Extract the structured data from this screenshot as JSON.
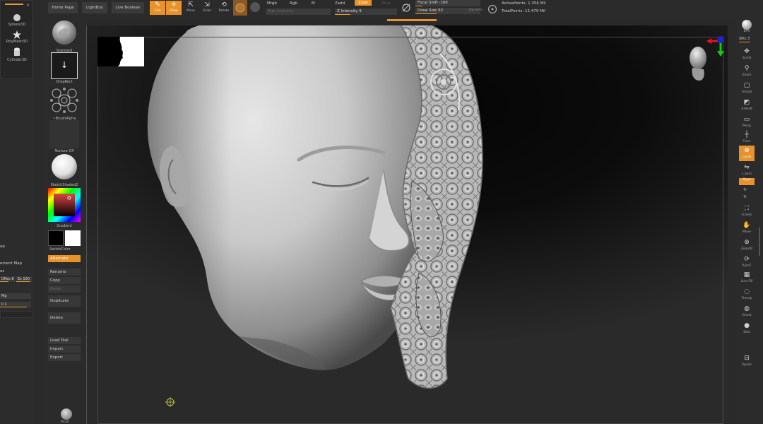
{
  "tray": {
    "primitives": [
      {
        "label": "Sphere3D",
        "icon": "sphere-icon"
      },
      {
        "label": "PolyMesh3D",
        "icon": "star-icon"
      },
      {
        "label": "Cylinder3D",
        "icon": "cylinder-icon"
      }
    ],
    "labels": {
      "map": "ap",
      "displacement_map": "ement Map",
      "res": "es"
    },
    "sliders": {
      "dres": "DRes 8",
      "es": "Es 100",
      "mp": "Mp",
      "count": "ii 1"
    }
  },
  "topbar": {
    "home_page": "Home Page",
    "lightbox": "LightBox",
    "live_boolean": "Live Boolean",
    "tools": [
      {
        "label": "Edit",
        "icon": "edit-icon",
        "active": true
      },
      {
        "label": "Draw",
        "icon": "draw-icon",
        "active": true
      },
      {
        "label": "Move",
        "icon": "move-icon",
        "active": false
      },
      {
        "label": "Scale",
        "icon": "scale-icon",
        "active": false
      },
      {
        "label": "Rotate",
        "icon": "rotate-icon",
        "active": false
      }
    ],
    "mrgb": "Mrgb",
    "rgb": "Rgb",
    "m": "M",
    "zadd": "Zadd",
    "zsub": "Zsub",
    "zcut": "Zcut",
    "rgb_intensity": "Rgb Intensity",
    "z_intensity": "Z Intensity 9",
    "focal_shift": "Focal Shift -100",
    "draw_size": "Draw Size 92",
    "dynamic": "Dynamic",
    "active_points": "ActivePoints: 1.356 Mil",
    "total_points": "TotalPoints: 12.479 Mil",
    "accent": "#e7922a"
  },
  "shelf": {
    "brush": "Standard",
    "stroke": "DragRect",
    "alpha": "~BrushAlpha",
    "texture": "Texture Off",
    "material": "SketchShaded2",
    "gradient": "Gradient",
    "switch_color": "SwitchColor",
    "alternate": "Alternate",
    "buttons": [
      "Rename",
      "Copy",
      "Paste",
      "Duplicate",
      "Delete",
      "Load Tool",
      "Import",
      "Export"
    ],
    "bottom": "Pinch"
  },
  "rshelf": {
    "bpr": "BPR",
    "spix": "SPix 3",
    "buttons": [
      {
        "label": "Scroll",
        "icon": "scroll-icon"
      },
      {
        "label": "Zoom",
        "icon": "zoom-icon"
      },
      {
        "label": "Actual",
        "icon": "actual-icon"
      },
      {
        "label": "AAHalf",
        "icon": "aahalf-icon"
      },
      {
        "label": "Persp",
        "icon": "persp-icon"
      },
      {
        "label": "Floor",
        "icon": "floor-icon"
      },
      {
        "label": "Local",
        "icon": "local-icon",
        "active": true
      },
      {
        "label": "L.Sym",
        "icon": "lsym-icon"
      },
      {
        "label": "Qxyz",
        "icon": "xyz-icon",
        "active": true
      },
      {
        "label": "Frame",
        "icon": "frame-icon"
      },
      {
        "label": "Move",
        "icon": "move-view-icon"
      },
      {
        "label": "ZoomD",
        "icon": "zoom3d-icon"
      },
      {
        "label": "RotaT",
        "icon": "rotate-view-icon"
      },
      {
        "label": "Line Fill",
        "icon": "linefill-icon"
      },
      {
        "label": "Transp",
        "icon": "transp-icon"
      },
      {
        "label": "Ghost",
        "icon": "ghost-icon"
      },
      {
        "label": "Solo",
        "icon": "solo-icon"
      },
      {
        "label": "Xpose",
        "icon": "xpose-icon"
      }
    ]
  }
}
